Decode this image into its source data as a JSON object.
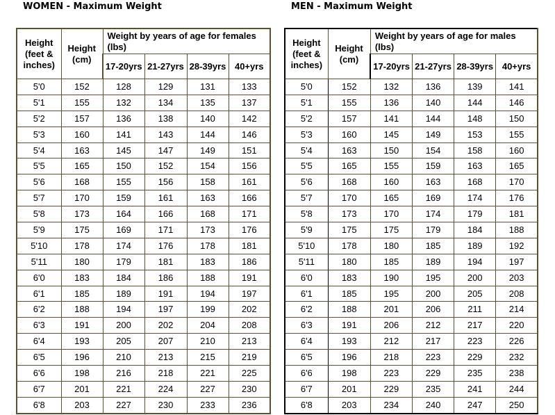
{
  "women": {
    "title": "WOMEN - Maximum Weight",
    "headers": {
      "height_ft": "Height (feet & inches)",
      "height_cm": "Height (cm)",
      "group": "Weight by years of age for females (lbs)",
      "ages": [
        "17-20yrs",
        "21-27yrs",
        "28-39yrs",
        "40+yrs"
      ]
    },
    "rows": [
      [
        "5'0",
        "152",
        "128",
        "129",
        "131",
        "133"
      ],
      [
        "5'1",
        "155",
        "132",
        "134",
        "135",
        "137"
      ],
      [
        "5'2",
        "157",
        "136",
        "138",
        "140",
        "142"
      ],
      [
        "5'3",
        "160",
        "141",
        "143",
        "144",
        "146"
      ],
      [
        "5'4",
        "163",
        "145",
        "147",
        "149",
        "151"
      ],
      [
        "5'5",
        "165",
        "150",
        "152",
        "154",
        "156"
      ],
      [
        "5'6",
        "168",
        "155",
        "156",
        "158",
        "161"
      ],
      [
        "5'7",
        "170",
        "159",
        "161",
        "163",
        "166"
      ],
      [
        "5'8",
        "173",
        "164",
        "166",
        "168",
        "171"
      ],
      [
        "5'9",
        "175",
        "169",
        "171",
        "173",
        "176"
      ],
      [
        "5'10",
        "178",
        "174",
        "176",
        "178",
        "181"
      ],
      [
        "5'11",
        "180",
        "179",
        "181",
        "183",
        "186"
      ],
      [
        "6'0",
        "183",
        "184",
        "186",
        "188",
        "191"
      ],
      [
        "6'1",
        "185",
        "189",
        "191",
        "194",
        "197"
      ],
      [
        "6'2",
        "188",
        "194",
        "197",
        "199",
        "202"
      ],
      [
        "6'3",
        "191",
        "200",
        "202",
        "204",
        "208"
      ],
      [
        "6'4",
        "193",
        "205",
        "207",
        "210",
        "213"
      ],
      [
        "6'5",
        "196",
        "210",
        "213",
        "215",
        "219"
      ],
      [
        "6'6",
        "198",
        "216",
        "218",
        "221",
        "225"
      ],
      [
        "6'7",
        "201",
        "221",
        "224",
        "227",
        "230"
      ],
      [
        "6'8",
        "203",
        "227",
        "230",
        "233",
        "236"
      ]
    ]
  },
  "men": {
    "title": "MEN - Maximum Weight",
    "headers": {
      "height_ft": "Height (feet & inches)",
      "height_cm": "Height (cm)",
      "group": "Weight by years of age for males (lbs)",
      "ages": [
        "17-20yrs",
        "21-27yrs",
        "28-39yrs",
        "40+yrs"
      ]
    },
    "rows": [
      [
        "5'0",
        "152",
        "132",
        "136",
        "139",
        "141"
      ],
      [
        "5'1",
        "155",
        "136",
        "140",
        "144",
        "146"
      ],
      [
        "5'2",
        "157",
        "141",
        "144",
        "148",
        "150"
      ],
      [
        "5'3",
        "160",
        "145",
        "149",
        "153",
        "155"
      ],
      [
        "5'4",
        "163",
        "150",
        "154",
        "158",
        "160"
      ],
      [
        "5'5",
        "165",
        "155",
        "159",
        "163",
        "165"
      ],
      [
        "5'6",
        "168",
        "160",
        "163",
        "168",
        "170"
      ],
      [
        "5'7",
        "170",
        "165",
        "169",
        "174",
        "176"
      ],
      [
        "5'8",
        "173",
        "170",
        "174",
        "179",
        "181"
      ],
      [
        "5'9",
        "175",
        "175",
        "179",
        "184",
        "188"
      ],
      [
        "5'10",
        "178",
        "180",
        "185",
        "189",
        "192"
      ],
      [
        "5'11",
        "180",
        "185",
        "189",
        "194",
        "197"
      ],
      [
        "6'0",
        "183",
        "190",
        "195",
        "200",
        "203"
      ],
      [
        "6'1",
        "185",
        "195",
        "200",
        "205",
        "208"
      ],
      [
        "6'2",
        "188",
        "201",
        "206",
        "211",
        "214"
      ],
      [
        "6'3",
        "191",
        "206",
        "212",
        "217",
        "220"
      ],
      [
        "6'4",
        "193",
        "212",
        "217",
        "223",
        "226"
      ],
      [
        "6'5",
        "196",
        "218",
        "223",
        "229",
        "232"
      ],
      [
        "6'6",
        "198",
        "223",
        "229",
        "235",
        "238"
      ],
      [
        "6'7",
        "201",
        "229",
        "235",
        "241",
        "244"
      ],
      [
        "6'8",
        "203",
        "234",
        "240",
        "247",
        "250"
      ]
    ]
  },
  "colors": {
    "border": "#5c5030",
    "text": "#000000",
    "background": "#ffffff"
  }
}
